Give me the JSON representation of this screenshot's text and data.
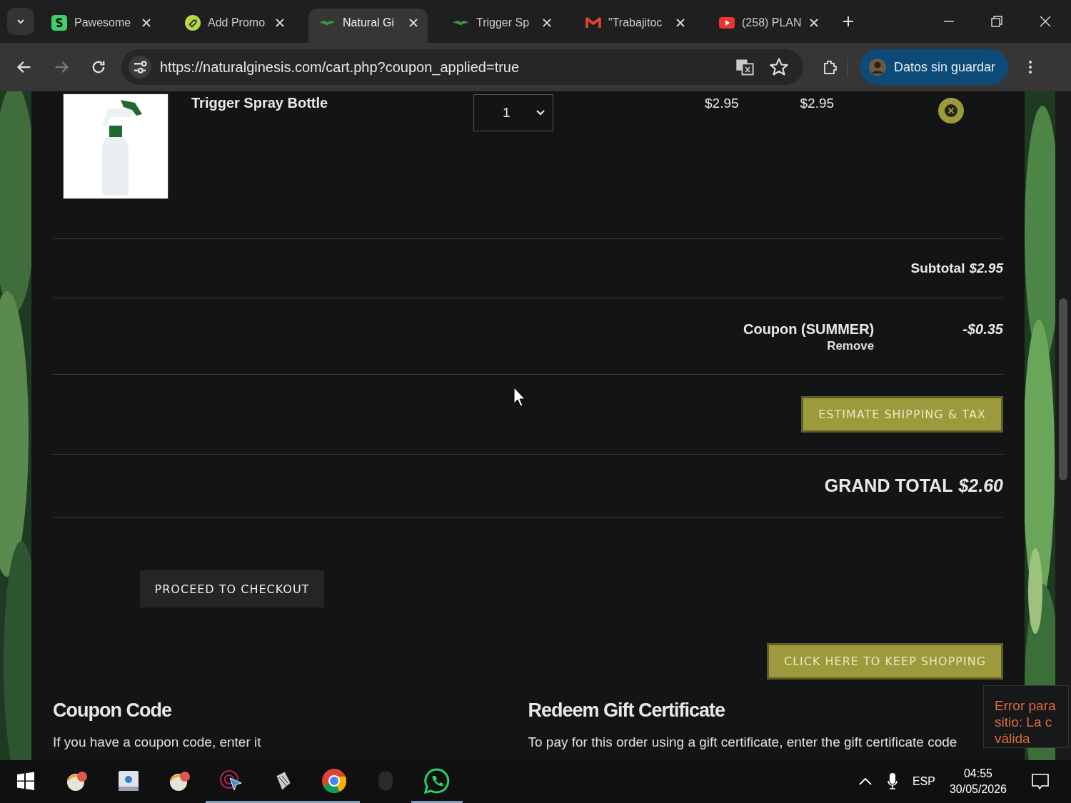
{
  "tabs": [
    {
      "label": "Pawesome",
      "selected": false
    },
    {
      "label": "Add Promo",
      "selected": false
    },
    {
      "label": "Natural Gi",
      "selected": true
    },
    {
      "label": "Trigger Sp",
      "selected": false
    },
    {
      "label": "\"Trabajitoc",
      "selected": false
    },
    {
      "label": "(258) PLAN",
      "selected": false
    }
  ],
  "url": "https://naturalginesis.com/cart.php?coupon_applied=true",
  "profile": {
    "label": "Datos sin guardar"
  },
  "cart_item": {
    "name": "Trigger Spray Bottle",
    "quantity": "1",
    "price": "$2.95",
    "total": "$2.95"
  },
  "subtotal": {
    "label": "Subtotal",
    "value": "$2.95"
  },
  "coupon": {
    "label": "Coupon (SUMMER)",
    "remove": "Remove",
    "value": "-$0.35"
  },
  "estimate_button": "ESTIMATE SHIPPING & TAX",
  "grand_total": {
    "label": "GRAND TOTAL",
    "value": "$2.60"
  },
  "checkout_button": "PROCEED TO CHECKOUT",
  "keep_shopping_button": "CLICK HERE TO KEEP SHOPPING",
  "sections": [
    {
      "title": "Coupon Code",
      "text": "If you have a coupon code, enter it"
    },
    {
      "title": "Redeem Gift Certificate",
      "text": "To pay for this order using a gift certificate, enter the gift certificate code"
    }
  ],
  "error_toast": {
    "lines": [
      "Error para",
      "sitio: La c",
      "válida"
    ]
  },
  "taskbar": {
    "apps": [
      {
        "kind": "start",
        "active": false
      },
      {
        "kind": "orb",
        "active": false
      },
      {
        "kind": "drive",
        "active": false
      },
      {
        "kind": "orb",
        "active": false
      },
      {
        "kind": "pointer",
        "active": true
      },
      {
        "kind": "tool",
        "active": true
      },
      {
        "kind": "chrome",
        "active": true
      },
      {
        "kind": "mouse",
        "active": false
      },
      {
        "kind": "whatsapp",
        "active": true
      }
    ],
    "language": "ESP",
    "time": "04:55",
    "date": "30/05/2026"
  }
}
